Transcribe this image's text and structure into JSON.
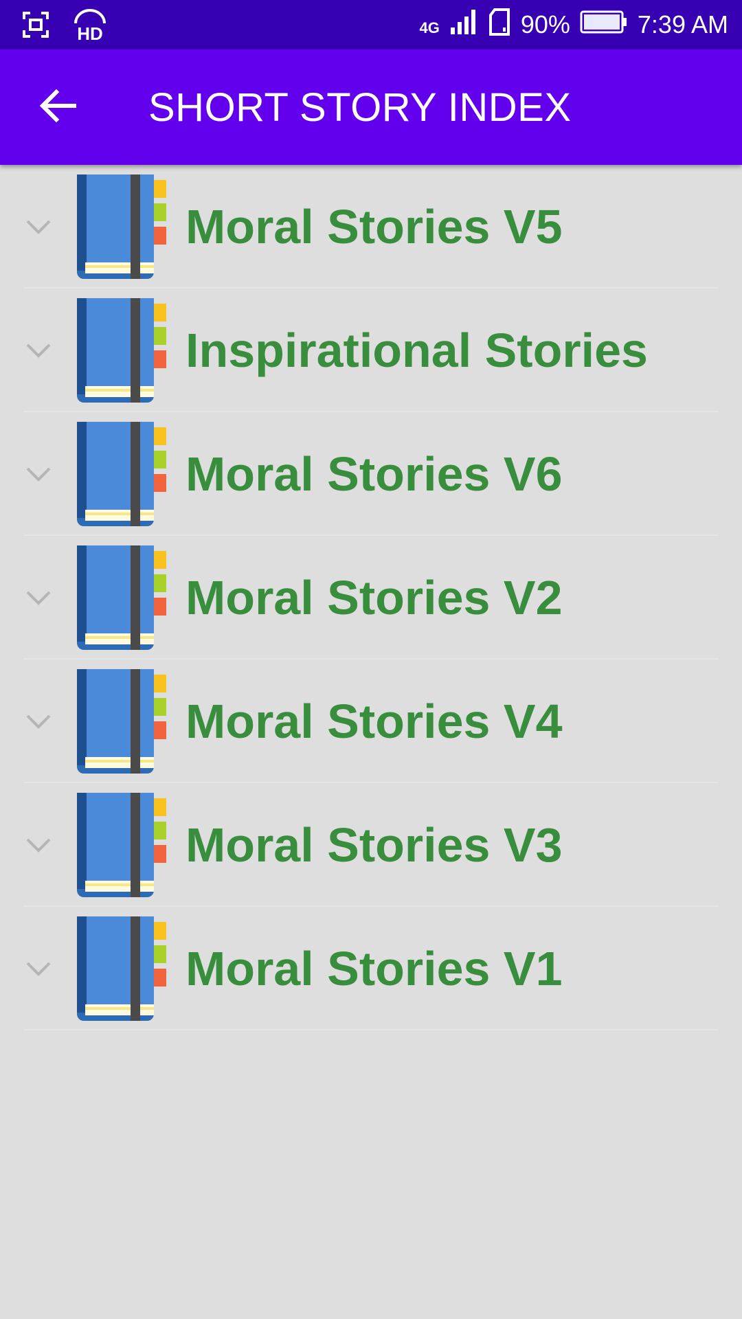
{
  "status_bar": {
    "left_icons": [
      "screenshot-icon",
      "hd-headset-icon"
    ],
    "network": "4G",
    "battery_percent": "90%",
    "time": "7:39 AM"
  },
  "app_bar": {
    "back_icon": "arrow-back-icon",
    "title": "SHORT STORY INDEX"
  },
  "stories": [
    {
      "title": "Moral Stories V5"
    },
    {
      "title": "Inspirational Stories"
    },
    {
      "title": "Moral Stories V6"
    },
    {
      "title": "Moral Stories V2"
    },
    {
      "title": "Moral Stories V4"
    },
    {
      "title": "Moral Stories V3"
    },
    {
      "title": "Moral Stories V1"
    }
  ],
  "colors": {
    "status_bar": "#3700b3",
    "app_bar": "#6200ee",
    "title_text": "#388e3c",
    "background": "#dedede"
  }
}
